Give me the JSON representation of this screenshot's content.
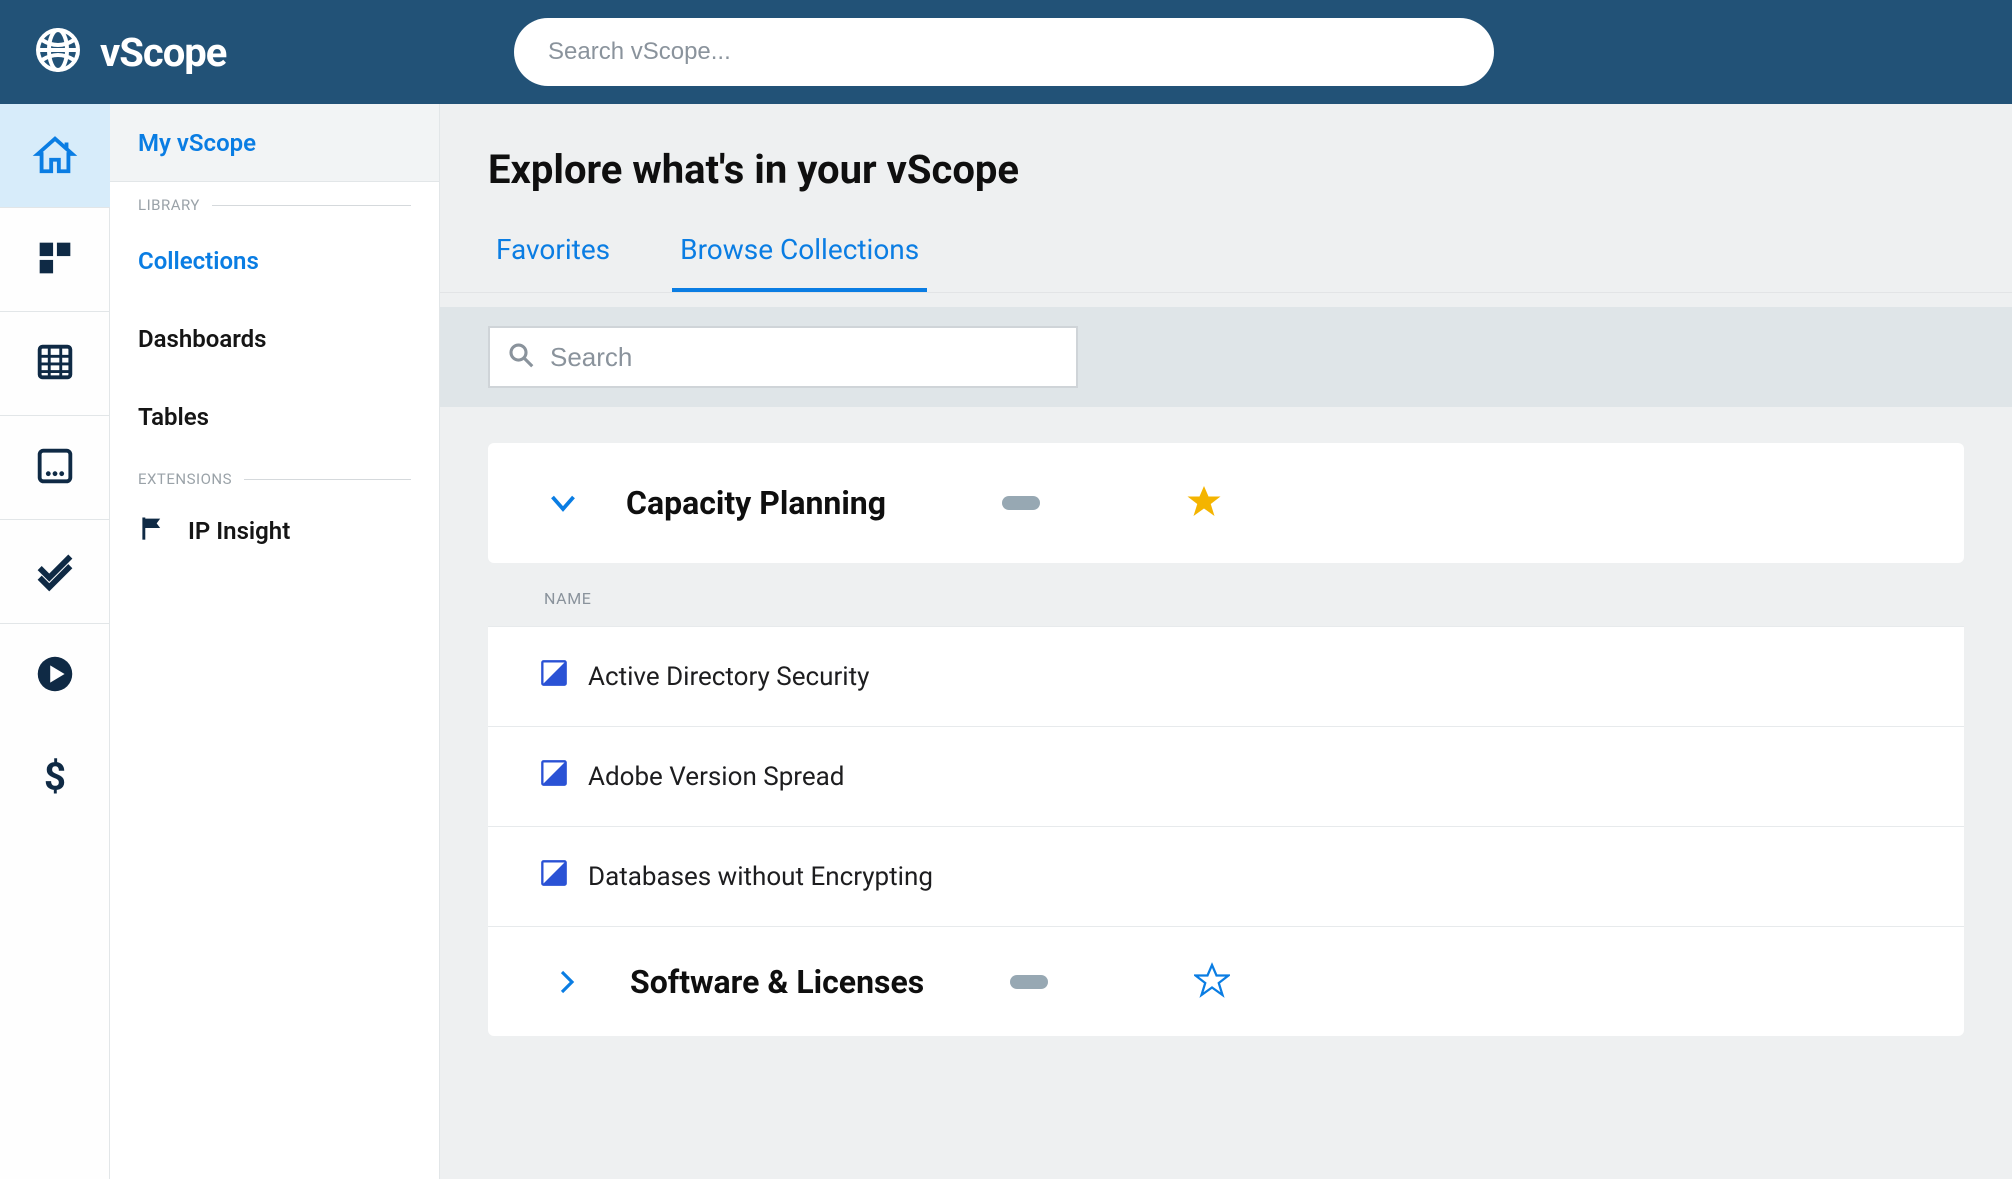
{
  "brand": {
    "name": "vScope"
  },
  "search": {
    "placeholder": "Search vScope..."
  },
  "sidebar": {
    "my_label": "My vScope",
    "library_label": "LIBRARY",
    "extensions_label": "EXTENSIONS",
    "items": {
      "collections": "Collections",
      "dashboards": "Dashboards",
      "tables": "Tables"
    },
    "extensions": {
      "ip_insight": "IP Insight"
    }
  },
  "page": {
    "title": "Explore what's in your vScope",
    "tabs": {
      "favorites": "Favorites",
      "browse": "Browse Collections"
    },
    "filter_placeholder": "Search",
    "name_header": "NAME"
  },
  "collections": {
    "capacity": {
      "title": "Capacity Planning",
      "items": {
        "ad_security": "Active Directory Security",
        "adobe": "Adobe Version Spread",
        "db_encrypt": "Databases without Encrypting"
      }
    },
    "software": {
      "title": "Software & Licenses"
    }
  }
}
